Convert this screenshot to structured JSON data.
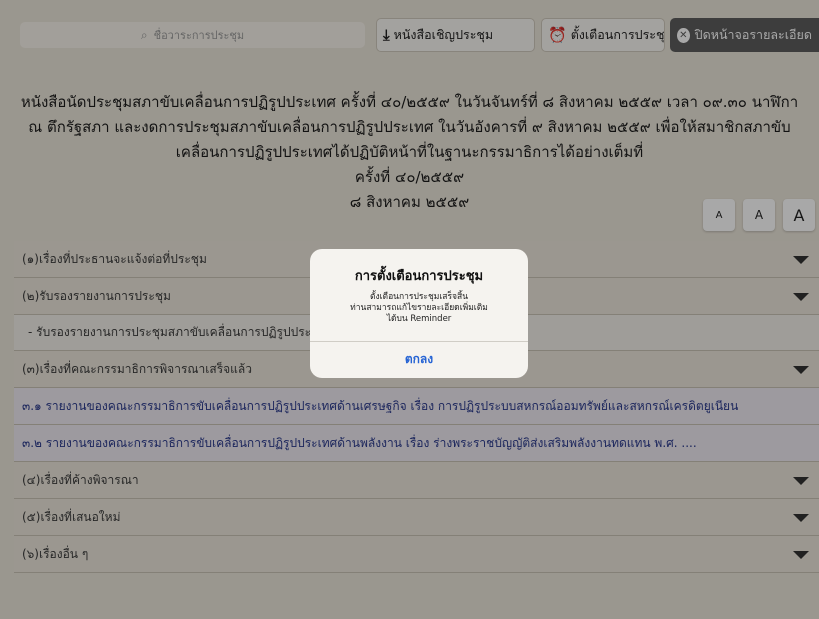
{
  "toolbar": {
    "search_placeholder": "ชื่อวาระการประชุม",
    "invite_label": "หนังสือเชิญประชุม",
    "remind_label": "ตั้งเตือนการประชุมนี้",
    "close_label": "ปิดหน้าจอรายละเอียด"
  },
  "title": {
    "line1": "หนังสือนัดประชุมสภาขับเคลื่อนการปฏิรูปประเทศ ครั้งที่ ๔๐/๒๕๕๙ ในวันจันทร์ที่ ๘ สิงหาคม ๒๕๕๙ เวลา ๐๙.๓๐ นาฬิกา",
    "line2": "ณ ตึกรัฐสภา และงดการประชุมสภาขับเคลื่อนการปฏิรูปประเทศ ในวันอังคารที่ ๙ สิงหาคม ๒๕๕๙ เพื่อให้สมาชิกสภาขับ",
    "line3": "เคลื่อนการปฏิรูปประเทศได้ปฏิบัติหน้าที่ในฐานะกรรมาธิการได้อย่างเต็มที่",
    "line4": "ครั้งที่ ๔๐/๒๕๕๙",
    "line5": "๘ สิงหาคม ๒๕๕๙"
  },
  "font_buttons": [
    "A",
    "A",
    "A"
  ],
  "agenda": [
    {
      "label": "(๑)เรื่องที่ประธานจะแจ้งต่อที่ประชุม",
      "type": "section"
    },
    {
      "label": "(๒)รับรองรายงานการประชุม",
      "type": "section"
    },
    {
      "label": "- รับรองรายงานการประชุมสภาขับเคลื่อนการปฏิรูปประเทศ",
      "type": "sub"
    },
    {
      "label": "(๓)เรื่องที่คณะกรรมาธิการพิจารณาเสร็จแล้ว",
      "type": "section"
    },
    {
      "label": "๓.๑ รายงานของคณะกรรมาธิการขับเคลื่อนการปฏิรูปประเทศด้านเศรษฐกิจ    เรื่อง การปฏิรูประบบสหกรณ์ออมทรัพย์และสหกรณ์เครดิตยูเนียน",
      "type": "item"
    },
    {
      "label": "๓.๒ รายงานของคณะกรรมาธิการขับเคลื่อนการปฏิรูปประเทศด้านพลังงาน    เรื่อง ร่างพระราชบัญญัติส่งเสริมพลังงานทดแทน พ.ศ. ....",
      "type": "item"
    },
    {
      "label": "(๔)เรื่องที่ค้างพิจารณา",
      "type": "section"
    },
    {
      "label": "(๕)เรื่องที่เสนอใหม่",
      "type": "section"
    },
    {
      "label": "(๖)เรื่องอื่น ๆ",
      "type": "section"
    }
  ],
  "dialog": {
    "title": "การตั้งเตือนการประชุม",
    "message1": "ตั้งเตือนการประชุมเสร็จสิ้น",
    "message2": "ท่านสามารถแก้ไขรายละเอียดเพิ่มเติม",
    "message3": "ได้บน Reminder",
    "ok_label": "ตกลง"
  },
  "icons": {
    "search": "magnifier-icon",
    "invite": "download-icon",
    "remind": "alarm-clock-icon",
    "close": "close-circle-icon",
    "expand": "caret-down-icon"
  }
}
